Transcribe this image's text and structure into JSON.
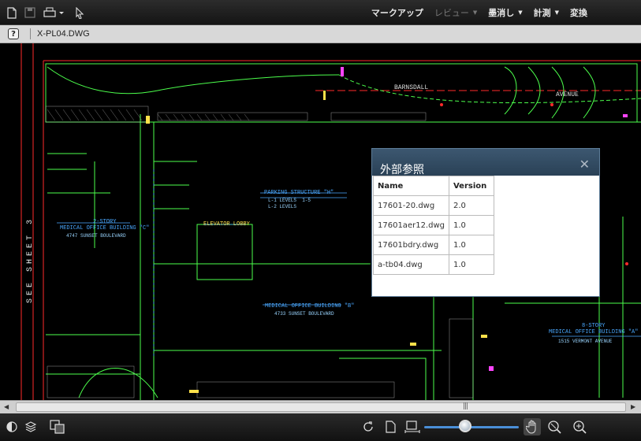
{
  "menu": {
    "markup": "マークアップ",
    "review": "レビュー",
    "ink": "墨消し",
    "measure": "計測",
    "convert": "変換"
  },
  "title": {
    "filename": "X-PL04.DWG"
  },
  "drawing": {
    "sheet_label": "SEE SHEET 3",
    "street_label": "BARNSDALL",
    "avenue_label": "AVENUE",
    "labels": [
      {
        "id": "parking",
        "title": "PARKING STRUCTURE \"H\"",
        "sub": "L-1 LEVELS  1-5\nL-2 LEVELS"
      },
      {
        "id": "mob_c",
        "title": "2-STORY\nMEDICAL OFFICE BUILDING \"C\"",
        "sub": "4747 SUNSET BOULEVARD"
      },
      {
        "id": "elevator",
        "title": "ELEVATOR LOBBY",
        "sub": ""
      },
      {
        "id": "mob_b",
        "title": "MEDICAL OFFICE BUILDING \"B\"",
        "sub": "4733 SUNSET BOULEVARD"
      },
      {
        "id": "mob_a",
        "title": "8-STORY\nMEDICAL OFFICE BUILDING \"A\"",
        "sub": "1515 VERMONT AVENUE"
      }
    ]
  },
  "xref_dialog": {
    "title": "外部参照",
    "columns": [
      "Name",
      "Version"
    ],
    "rows": [
      {
        "name": "17601-20.dwg",
        "version": "2.0"
      },
      {
        "name": "17601aer12.dwg",
        "version": "1.0"
      },
      {
        "name": "17601bdry.dwg",
        "version": "1.0"
      },
      {
        "name": "a-tb04.dwg",
        "version": "1.0"
      }
    ]
  },
  "zoom": {
    "level_fraction": 0.43
  },
  "colors": {
    "cad_green": "#4cff4c",
    "cad_red": "#ff2a2a",
    "cad_blue": "#4aa8ff",
    "cad_yellow": "#ffe14a",
    "dialog_header": "#34506a"
  },
  "icons": {
    "top": [
      "new-file-icon",
      "save-icon",
      "print-icon",
      "select-arrow-icon"
    ],
    "bottom": [
      "contrast-icon",
      "layers-icon",
      "xref-icon",
      "rotate-icon",
      "page-icon",
      "fit-width-icon",
      "pan-hand-icon",
      "zoom-window-icon",
      "zoom-icon"
    ]
  }
}
